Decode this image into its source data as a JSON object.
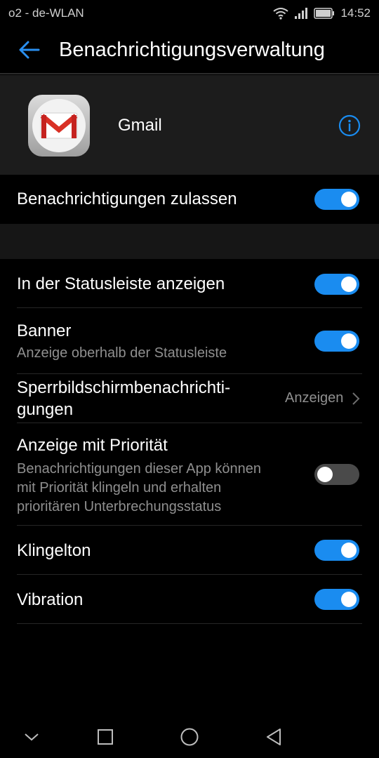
{
  "status_bar": {
    "carrier": "o2 - de-WLAN",
    "time": "14:52"
  },
  "app_bar": {
    "title": "Benachrichtigungsverwaltung",
    "back_icon": "arrow-back-icon"
  },
  "app_header": {
    "app_name": "Gmail",
    "app_icon": "gmail-icon",
    "info_icon": "info-icon"
  },
  "settings": {
    "allow": {
      "label": "Benachrichtigungen zulassen",
      "enabled": true
    },
    "statusbar": {
      "label": "In der Statusleiste anzeigen",
      "enabled": true
    },
    "banner": {
      "label": "Banner",
      "description": "Anzeige oberhalb der Statusleiste",
      "enabled": true
    },
    "lockscreen": {
      "label_line1": "Sperrbildschirmbenachrichti-",
      "label_line2": "gungen",
      "value": "Anzeigen"
    },
    "priority": {
      "label": "Anzeige mit Priorität",
      "desc_line1": "Benachrichtigungen dieser App können",
      "desc_line2": "mit Priorität klingeln und erhalten",
      "desc_line3": "prioritären Unterbrechungsstatus",
      "enabled": false
    },
    "ringtone": {
      "label": "Klingelton",
      "enabled": true
    },
    "vibration": {
      "label": "Vibration",
      "enabled": true
    }
  },
  "accent_color": "#1a8cf0"
}
